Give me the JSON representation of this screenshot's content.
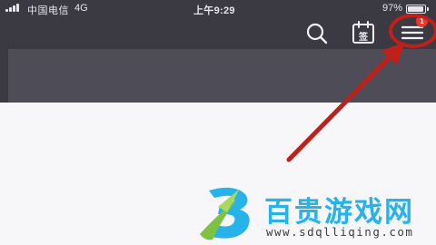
{
  "status_bar": {
    "carrier": "中国电信",
    "network": "4G",
    "time": "上午9:29",
    "battery_percent": "97%",
    "battery_level": 0.97
  },
  "app_bar": {
    "search_icon": "search-icon",
    "checkin_icon_label": "签",
    "menu_icon": "hamburger-menu-icon",
    "menu_badge": "1"
  },
  "annotation": {
    "color": "#c0201a"
  },
  "watermark": {
    "title": "百贵游戏网",
    "url": "www.sdqlliqing.com"
  },
  "colors": {
    "header_bg": "#3b3a42",
    "banner_bg": "#4e4d57",
    "page_bg": "#f7f7f9",
    "badge": "#f0352d",
    "watermark_blue": "#25b3ea",
    "watermark_green": "#7dc242"
  }
}
